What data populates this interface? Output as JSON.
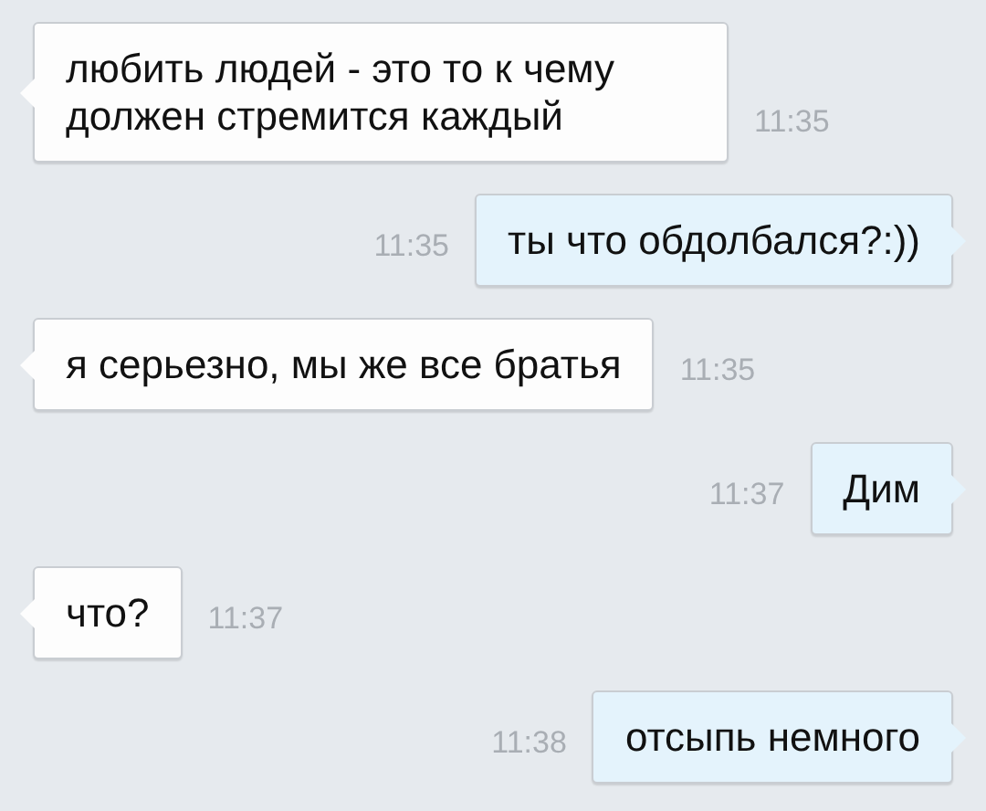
{
  "messages": [
    {
      "kind": "incoming",
      "text": "любить людей - это то к чему должен стремится каждый",
      "time": "11:35"
    },
    {
      "kind": "outgoing",
      "text": "ты что обдолбался?:))",
      "time": "11:35"
    },
    {
      "kind": "incoming",
      "text": "я серьезно, мы же все братья",
      "time": "11:35"
    },
    {
      "kind": "outgoing",
      "text": "Дим",
      "time": "11:37"
    },
    {
      "kind": "incoming",
      "text": "что?",
      "time": "11:37"
    },
    {
      "kind": "outgoing",
      "text": "отсыпь немного",
      "time": "11:38"
    }
  ]
}
